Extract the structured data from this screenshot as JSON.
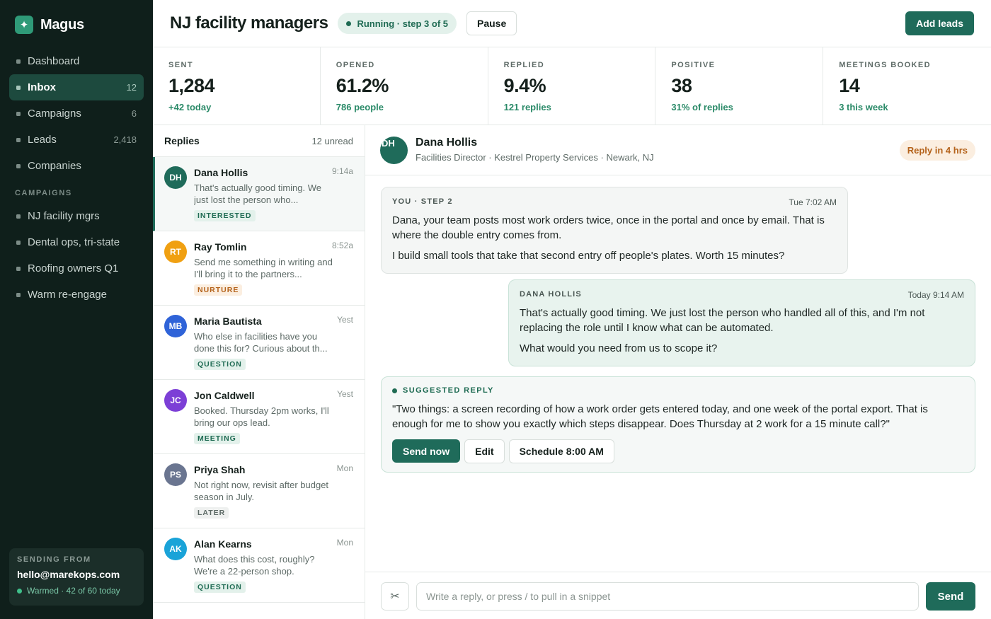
{
  "app": {
    "name": "Magus",
    "logo_glyph": "✦"
  },
  "sidebar": {
    "nav": [
      {
        "label": "Dashboard",
        "count": ""
      },
      {
        "label": "Inbox",
        "count": "12",
        "active": true
      },
      {
        "label": "Campaigns",
        "count": "6"
      },
      {
        "label": "Leads",
        "count": "2,418"
      },
      {
        "label": "Companies",
        "count": ""
      }
    ],
    "campaigns_heading": "CAMPAIGNS",
    "campaigns": [
      {
        "label": "NJ facility mgrs"
      },
      {
        "label": "Dental ops, tri-state"
      },
      {
        "label": "Roofing owners Q1"
      },
      {
        "label": "Warm re-engage"
      }
    ],
    "sender": {
      "label": "SENDING FROM",
      "email": "hello@marekops.com",
      "status": "Warmed · 42 of 60 today"
    }
  },
  "header": {
    "title": "NJ facility managers",
    "status": "Running · step 3 of 5",
    "pause_label": "Pause",
    "add_leads_label": "Add leads"
  },
  "stats": [
    {
      "label": "SENT",
      "value": "1,284",
      "sub": "+42 today"
    },
    {
      "label": "OPENED",
      "value": "61.2%",
      "sub": "786 people"
    },
    {
      "label": "REPLIED",
      "value": "9.4%",
      "sub": "121 replies"
    },
    {
      "label": "POSITIVE",
      "value": "38",
      "sub": "31% of replies"
    },
    {
      "label": "MEETINGS BOOKED",
      "value": "14",
      "sub": "3 this week"
    }
  ],
  "replies": {
    "title": "Replies",
    "unread": "12 unread",
    "items": [
      {
        "initials": "DH",
        "name": "Dana Hollis",
        "time": "9:14a",
        "snippet": "That's actually good timing. We just lost the person who...",
        "tag": "INTERESTED",
        "tag_class": "tag-interested",
        "avatar_color": "#1f6b5a",
        "active": true
      },
      {
        "initials": "RT",
        "name": "Ray Tomlin",
        "time": "8:52a",
        "snippet": "Send me something in writing and I'll bring it to the partners...",
        "tag": "NURTURE",
        "tag_class": "tag-nurture",
        "avatar_color": "#f0a012"
      },
      {
        "initials": "MB",
        "name": "Maria Bautista",
        "time": "Yest",
        "snippet": "Who else in facilities have you done this for? Curious about th...",
        "tag": "QUESTION",
        "tag_class": "tag-question",
        "avatar_color": "#2f63d8"
      },
      {
        "initials": "JC",
        "name": "Jon Caldwell",
        "time": "Yest",
        "snippet": "Booked. Thursday 2pm works, I'll bring our ops lead.",
        "tag": "MEETING",
        "tag_class": "tag-meeting",
        "avatar_color": "#7c3fd6"
      },
      {
        "initials": "PS",
        "name": "Priya Shah",
        "time": "Mon",
        "snippet": "Not right now, revisit after budget season in July.",
        "tag": "LATER",
        "tag_class": "tag-later",
        "avatar_color": "#6a7590"
      },
      {
        "initials": "AK",
        "name": "Alan Kearns",
        "time": "Mon",
        "snippet": "What does this cost, roughly? We're a 22-person shop.",
        "tag": "QUESTION",
        "tag_class": "tag-question",
        "avatar_color": "#1aa3d8"
      }
    ]
  },
  "conversation": {
    "initials": "DH",
    "name": "Dana Hollis",
    "meta": "Facilities Director · Kestrel Property Services · Newark, NJ",
    "badge": "Reply in 4 hrs",
    "outgoing": {
      "label": "YOU · STEP 2",
      "time": "Tue 7:02 AM",
      "p1": "Dana, your team posts most work orders twice, once in the portal and once by email. That is where the double entry comes from.",
      "p2": "I build small tools that take that second entry off people's plates. Worth 15 minutes?"
    },
    "incoming": {
      "label": "DANA HOLLIS",
      "time": "Today 9:14 AM",
      "p1": "That's actually good timing. We just lost the person who handled all of this, and I'm not replacing the role until I know what can be automated.",
      "p2": "What would you need from us to scope it?"
    },
    "suggested": {
      "label": "SUGGESTED REPLY",
      "text": "\"Two things: a screen recording of how a work order gets entered today, and one week of the portal export. That is enough for me to show you exactly which steps disappear. Does Thursday at 2 work for a 15 minute call?\"",
      "send_now": "Send now",
      "edit": "Edit",
      "schedule": "Schedule 8:00 AM"
    },
    "composer": {
      "snippet_glyph": "✂",
      "placeholder": "Write a reply, or press / to pull in a snippet",
      "value": "",
      "send": "Send"
    }
  },
  "colors": {
    "sidebar_bg": "#0f1f1b",
    "accent": "#1f6b5a",
    "positive_text": "#2a8a68",
    "warning_bg": "#fbeee0",
    "warning_text": "#b4621a"
  }
}
